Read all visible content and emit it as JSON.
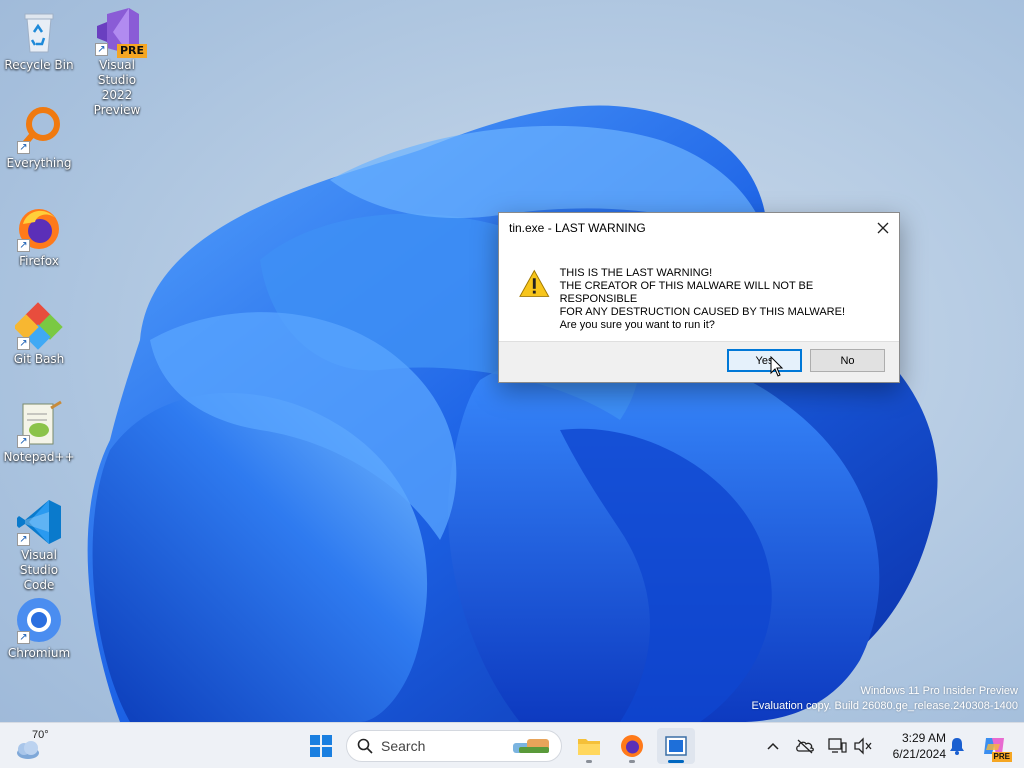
{
  "desktop": {
    "icons": [
      {
        "label": "Recycle Bin",
        "icon": "recycle-bin-icon"
      },
      {
        "label": "Visual Studio 2022 Preview",
        "label_line1": "Visual Studio",
        "label_line2": "2022 Preview",
        "badge": "PRE",
        "icon": "visual-studio-preview-icon"
      },
      {
        "label": "Everything",
        "icon": "everything-search-icon"
      },
      {
        "label": "Firefox",
        "icon": "firefox-icon"
      },
      {
        "label": "Git Bash",
        "icon": "git-bash-icon"
      },
      {
        "label": "Notepad++",
        "icon": "notepad-plus-plus-icon"
      },
      {
        "label": "Visual Studio Code",
        "label_line1": "Visual Studio",
        "label_line2": "Code",
        "icon": "vscode-icon"
      },
      {
        "label": "Chromium",
        "icon": "chromium-icon"
      }
    ]
  },
  "dialog": {
    "title": "tin.exe - LAST WARNING",
    "message_lines": [
      "THIS IS THE LAST WARNING!",
      "THE CREATOR OF THIS MALWARE WILL NOT BE RESPONSIBLE",
      "FOR ANY DESTRUCTION CAUSED BY THIS MALWARE!",
      "Are you sure you want to run it?"
    ],
    "yes_label": "Yes",
    "no_label": "No",
    "icon": "warning-icon"
  },
  "watermark": {
    "line1": "Windows 11 Pro Insider Preview",
    "line2": "Evaluation copy. Build 26080.ge_release.240308-1400"
  },
  "taskbar": {
    "weather_temp": "70°",
    "search_placeholder": "Search",
    "pinned": [
      "start-button",
      "search",
      "file-explorer",
      "firefox",
      "tin-app"
    ],
    "clock_time": "3:29 AM",
    "clock_date": "6/21/2024",
    "copilot_badge": "PRE"
  },
  "colors": {
    "accent": "#0078d7",
    "wallpaper_blue": "#1a5fe0",
    "taskbar_bg": "#eef1f6"
  }
}
